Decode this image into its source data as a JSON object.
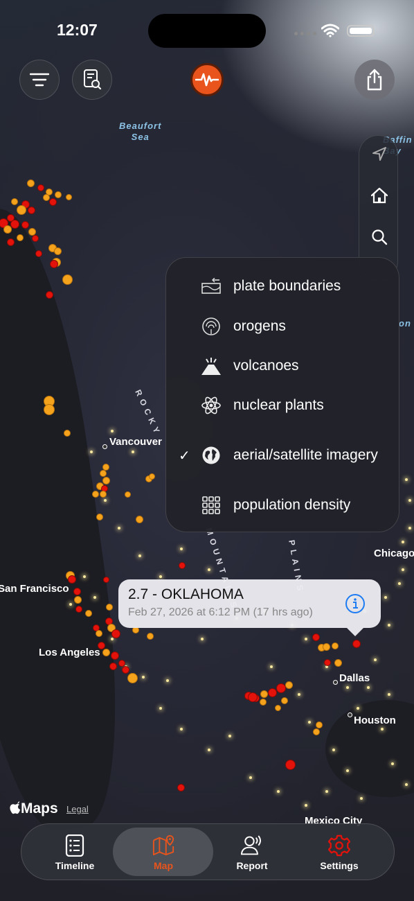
{
  "status_bar": {
    "time": "12:07"
  },
  "map": {
    "sea_labels": [
      {
        "text": "Beaufort\nSea"
      }
    ],
    "cities": [
      "Vancouver",
      "San Francisco",
      "Los Angeles",
      "Dallas",
      "Houston",
      "Chicago",
      "Mexico City"
    ],
    "range_labels": [
      "ROCKY",
      "MOUNTAINS",
      "PLAINS"
    ],
    "edge_labels": [
      "Baffin\nBay",
      "on"
    ]
  },
  "layers_menu": {
    "items": [
      {
        "label": "plate boundaries",
        "icon": "plate-boundaries-icon",
        "checked": false
      },
      {
        "label": "orogens",
        "icon": "orogens-icon",
        "checked": false
      },
      {
        "label": "volcanoes",
        "icon": "volcano-icon",
        "checked": false
      },
      {
        "label": "nuclear plants",
        "icon": "atom-icon",
        "checked": false
      },
      {
        "label": "aerial/satellite imagery",
        "icon": "globe-icon",
        "checked": true
      },
      {
        "label": "population density",
        "icon": "grid-icon",
        "checked": false
      }
    ],
    "check_mark": "✓"
  },
  "callout": {
    "title": "2.7 - OKLAHOMA",
    "subtitle": "Feb 27, 2026 at 6:12 PM (17 hrs ago)"
  },
  "attribution": {
    "maps": "Maps",
    "legal": "Legal"
  },
  "tabbar": {
    "tabs": [
      {
        "label": "Timeline",
        "active": false
      },
      {
        "label": "Map",
        "active": true
      },
      {
        "label": "Report",
        "active": false
      },
      {
        "label": "Settings",
        "active": false
      }
    ]
  },
  "colors": {
    "accent_active": "#e8541c",
    "quake_red": "#e3120b",
    "quake_orange": "#f5a21c",
    "info_blue": "#1e7cf2"
  }
}
